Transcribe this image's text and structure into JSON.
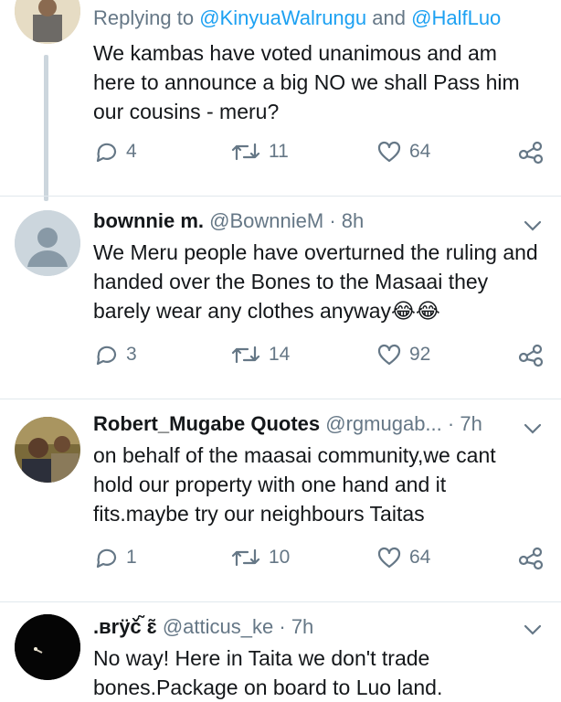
{
  "tweets": [
    {
      "replying_prefix": "Replying to",
      "replying_mentions": [
        "@KinyuaWalrungu",
        "@HalfLuo"
      ],
      "replying_and": "and",
      "text": "We kambas have voted unanimous  and am here to announce a big NO we shall Pass him our cousins - meru?",
      "replies": "4",
      "retweets": "11",
      "likes": "64"
    },
    {
      "name": "bownnie m.",
      "handle": "@BownnieM",
      "dot": "·",
      "time": "8h",
      "text": "We Meru people have overturned the ruling and handed over the Bones to the Masaai they barely wear any clothes anyway",
      "emoji": "😂😂",
      "replies": "3",
      "retweets": "14",
      "likes": "92"
    },
    {
      "name": "Robert_Mugabe Quotes",
      "handle": "@rgmugab...",
      "dot": "·",
      "time": "7h",
      "text": "on behalf of the maasai community,we cant hold our property with one hand and it fits.maybe try our neighbours Taitas",
      "replies": "1",
      "retweets": "10",
      "likes": "64"
    },
    {
      "name": ".ʙrÿč ̃ɛ̃ ",
      "handle": "@atticus_ke",
      "dot": "·",
      "time": "7h",
      "text": "No way! Here in Taita we don't trade bones.Package on board to Luo land."
    }
  ],
  "colors": {
    "link": "#1da1f2",
    "secondary": "#657786",
    "thread_line": "#ccd6dd"
  },
  "icons": [
    "reply-icon",
    "retweet-icon",
    "like-icon",
    "share-icon",
    "chevron-down-icon"
  ]
}
